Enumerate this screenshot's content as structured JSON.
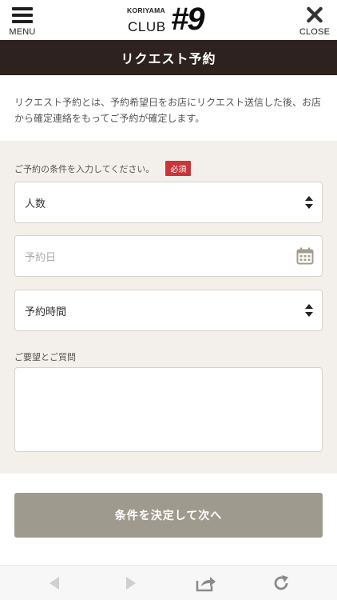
{
  "header": {
    "menu_label": "MENU",
    "close_label": "CLOSE",
    "logo_small": "KORIYAMA",
    "logo_club": "CLUB",
    "logo_number": "#9"
  },
  "page_title": "リクエスト予約",
  "intro_text": "リクエスト予約とは、予約希望日をお店にリクエスト送信した後、お店から確定連絡をもってご予約が確定します。",
  "form": {
    "conditions_label": "ご予約の条件を入力してください。",
    "required_badge": "必須",
    "people_value": "人数",
    "date_placeholder": "予約日",
    "time_value": "予約時間",
    "comment_label": "ご要望とご質問",
    "comment_value": ""
  },
  "submit_label": "条件を決定して次へ",
  "icons": {
    "menu": "hamburger-icon",
    "close": "close-icon",
    "select": "select-arrows-icon",
    "calendar": "calendar-icon",
    "back": "back-arrow-icon",
    "forward": "forward-arrow-icon",
    "share": "share-icon",
    "reload": "reload-icon"
  },
  "colors": {
    "title_bar": "#2e2220",
    "required_badge": "#c9353a",
    "submit_button": "#9e9a8e",
    "form_background": "#f3f0eb"
  }
}
